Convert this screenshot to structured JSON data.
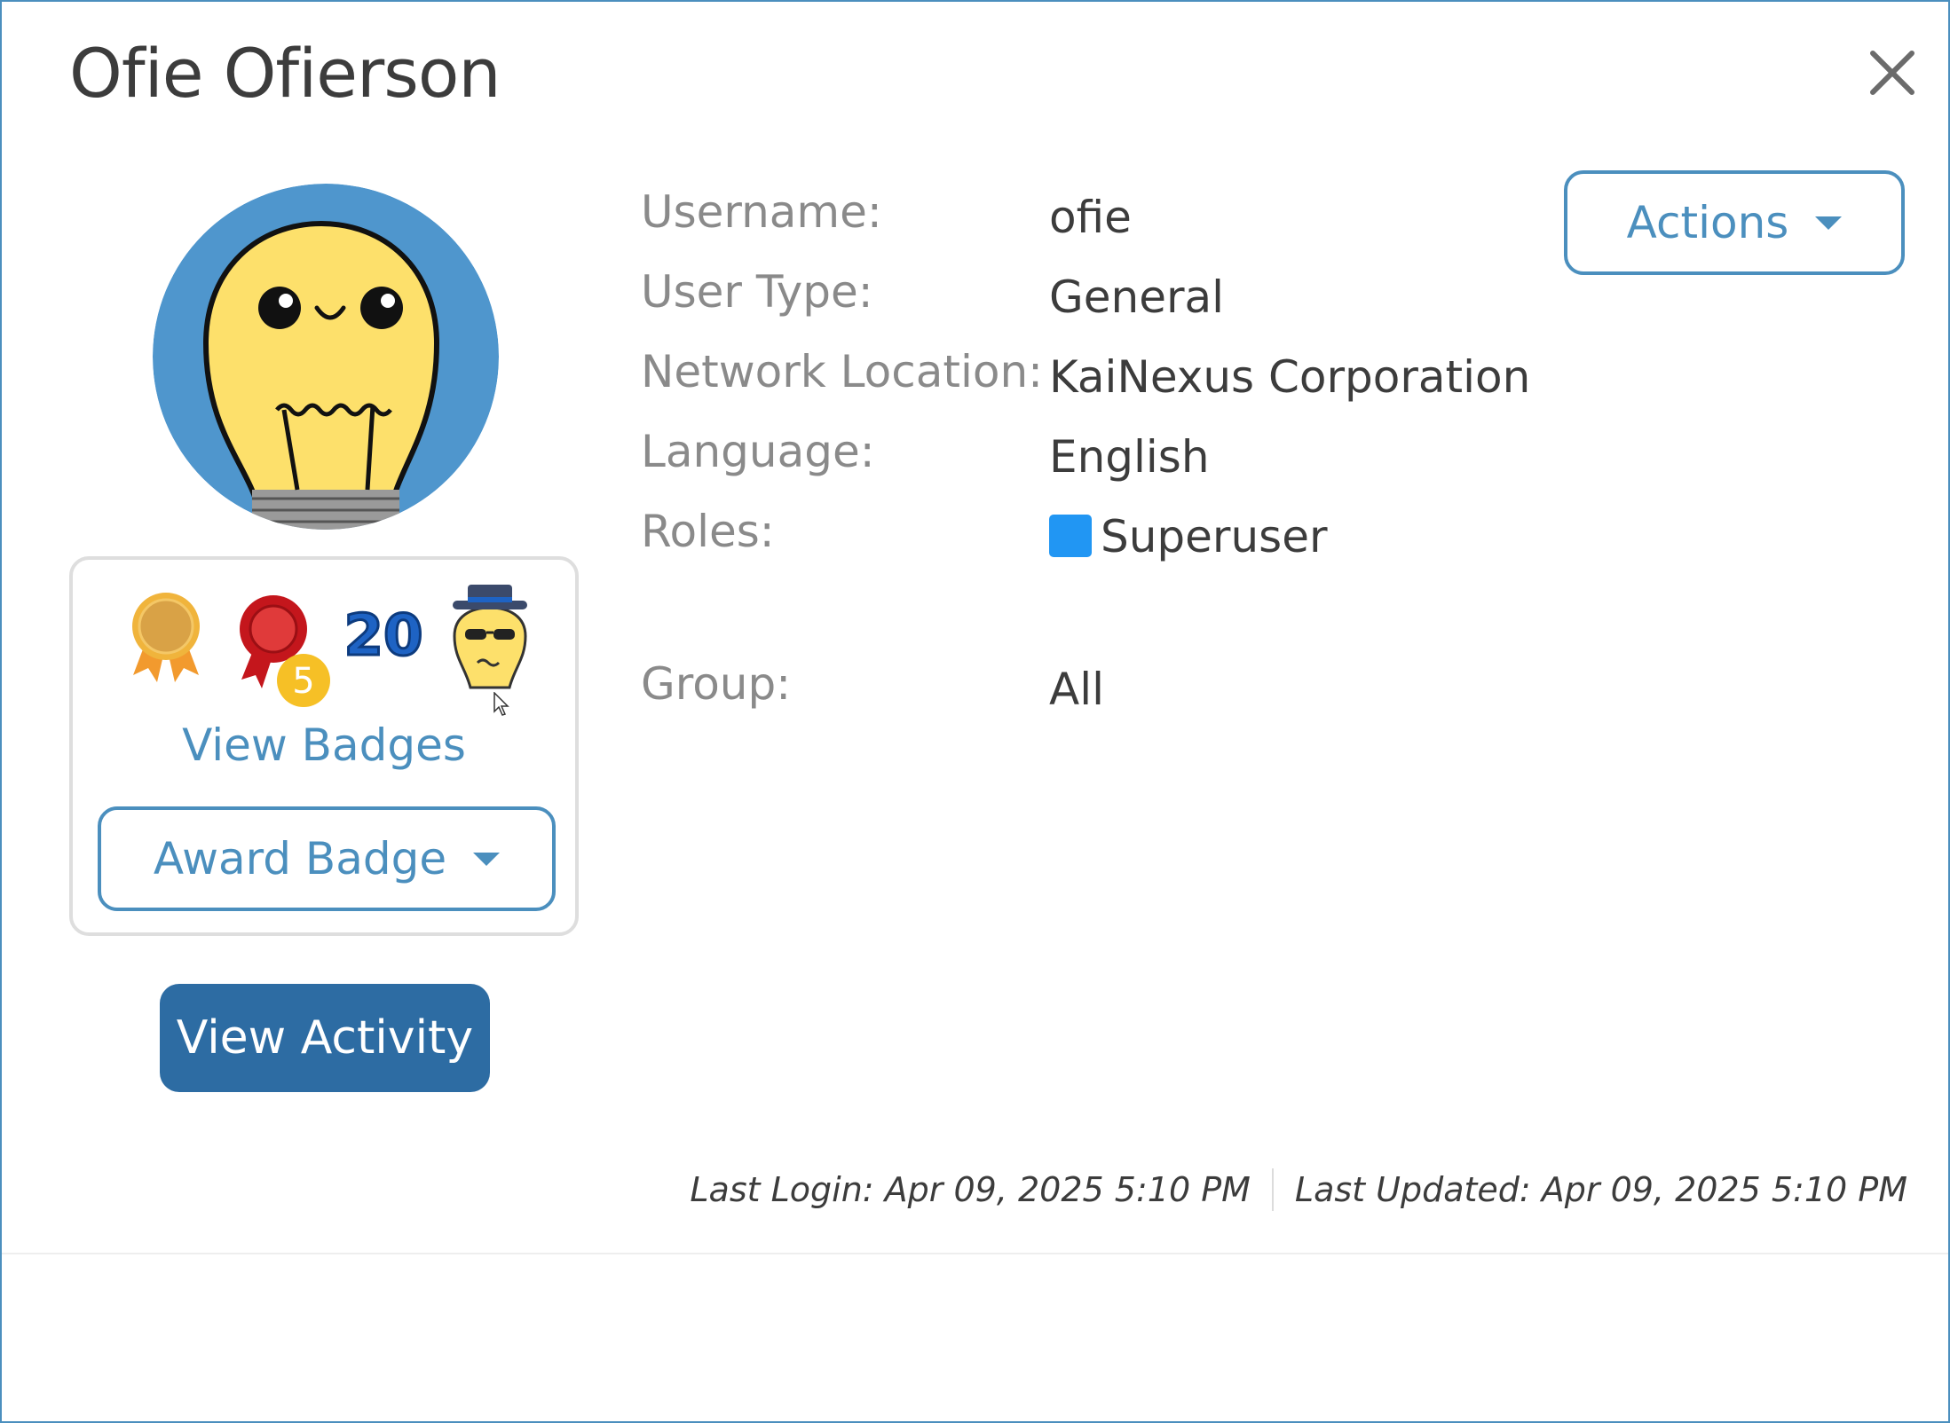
{
  "profile": {
    "name": "Ofie Ofierson"
  },
  "fields": [
    {
      "label": "Username:",
      "value": "ofie"
    },
    {
      "label": "User Type:",
      "value": "General"
    },
    {
      "label": "Network Location:",
      "value": "KaiNexus Corporation"
    },
    {
      "label": "Language:",
      "value": "English"
    },
    {
      "label": "Roles:",
      "value": "Superuser"
    },
    {
      "label": "Group:",
      "value": "All"
    }
  ],
  "badges": {
    "count_badge_number": "5",
    "milestone_number": "20",
    "view_label": "View Badges",
    "award_label": "Award Badge"
  },
  "buttons": {
    "actions_label": "Actions",
    "view_activity_label": "View Activity"
  },
  "footer": {
    "last_login": "Last Login: Apr 09, 2025 5:10 PM",
    "last_updated": "Last Updated: Apr 09, 2025 5:10 PM"
  },
  "colors": {
    "accent": "#4b8fbe",
    "primary_button": "#2d6ca3",
    "role_swatch": "#2196f3",
    "avatar_bg": "#4f96cd"
  },
  "icons": [
    "close-icon",
    "lightbulb-avatar",
    "gold-ribbon-badge",
    "red-rosette-badge",
    "number-20-badge",
    "spy-bulb-badge",
    "caret-down-icon",
    "cursor-icon"
  ]
}
